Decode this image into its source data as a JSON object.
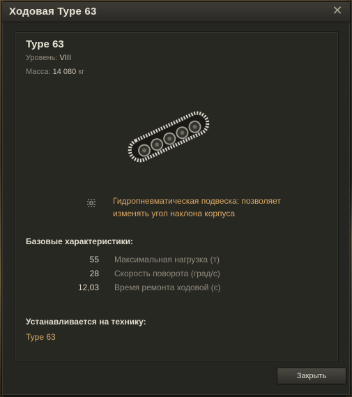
{
  "window": {
    "title": "Ходовая Type 63",
    "close_icon": "close-icon"
  },
  "item": {
    "name": "Type 63",
    "level_label": "Уровень:",
    "level_value": "VIII",
    "mass_label": "Масса:",
    "mass_value": "14 080",
    "mass_unit": "кг",
    "image_icon": "tank-tracks-icon"
  },
  "feature": {
    "icon": "suspension-icon",
    "text": "Гидропневматическая подвеска: позволяет изменять угол наклона корпуса"
  },
  "stats": {
    "title": "Базовые характеристики:",
    "rows": [
      {
        "value": "55",
        "label": "Максимальная нагрузка",
        "unit": "(т)"
      },
      {
        "value": "28",
        "label": "Скорость поворота",
        "unit": "(град/с)"
      },
      {
        "value": "12,03",
        "label": "Время ремонта ходовой",
        "unit": "(с)"
      }
    ]
  },
  "installs": {
    "title": "Устанавливается на технику:",
    "vehicle": "Type 63"
  },
  "footer": {
    "close_button": "Закрыть"
  },
  "colors": {
    "accent": "#d8a867",
    "text": "#cfc8b6",
    "muted": "#8f8a7c",
    "panel": "#282823"
  }
}
